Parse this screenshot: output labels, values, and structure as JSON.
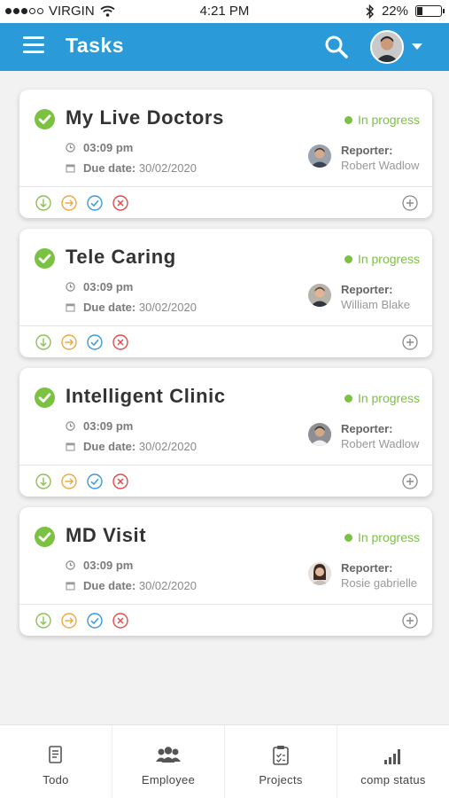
{
  "status_bar": {
    "carrier": "VIRGIN",
    "time": "4:21 PM",
    "battery_text": "22%",
    "battery_level": 0.22
  },
  "app_bar": {
    "title": "Tasks"
  },
  "tasks": [
    {
      "title": "My Live Doctors",
      "status": "In progress",
      "time": "03:09 pm",
      "due_label": "Due date:",
      "due_date": "30/02/2020",
      "reporter_label": "Reporter:",
      "reporter_name": "Robert Wadlow"
    },
    {
      "title": "Tele Caring",
      "status": "In progress",
      "time": "03:09 pm",
      "due_label": "Due date:",
      "due_date": "30/02/2020",
      "reporter_label": "Reporter:",
      "reporter_name": "William Blake"
    },
    {
      "title": "Intelligent Clinic",
      "status": "In progress",
      "time": "03:09 pm",
      "due_label": "Due date:",
      "due_date": "30/02/2020",
      "reporter_label": "Reporter:",
      "reporter_name": "Robert Wadlow"
    },
    {
      "title": "MD Visit",
      "status": "In progress",
      "time": "03:09 pm",
      "due_label": "Due date:",
      "due_date": "30/02/2020",
      "reporter_label": "Reporter:",
      "reporter_name": "Rosie gabrielle"
    }
  ],
  "bottom_nav": [
    {
      "label": "Todo",
      "icon": "todo-icon"
    },
    {
      "label": "Employee",
      "icon": "employee-icon"
    },
    {
      "label": "Projects",
      "icon": "projects-icon"
    },
    {
      "label": "comp status",
      "icon": "signal-bars-icon"
    }
  ],
  "colors": {
    "app_bar": "#2a9ad8",
    "status_green": "#7cc242",
    "action_down": "#8cc152",
    "action_forward": "#f0a93c",
    "action_done": "#3a9ad9",
    "action_cancel": "#e04b4b"
  }
}
